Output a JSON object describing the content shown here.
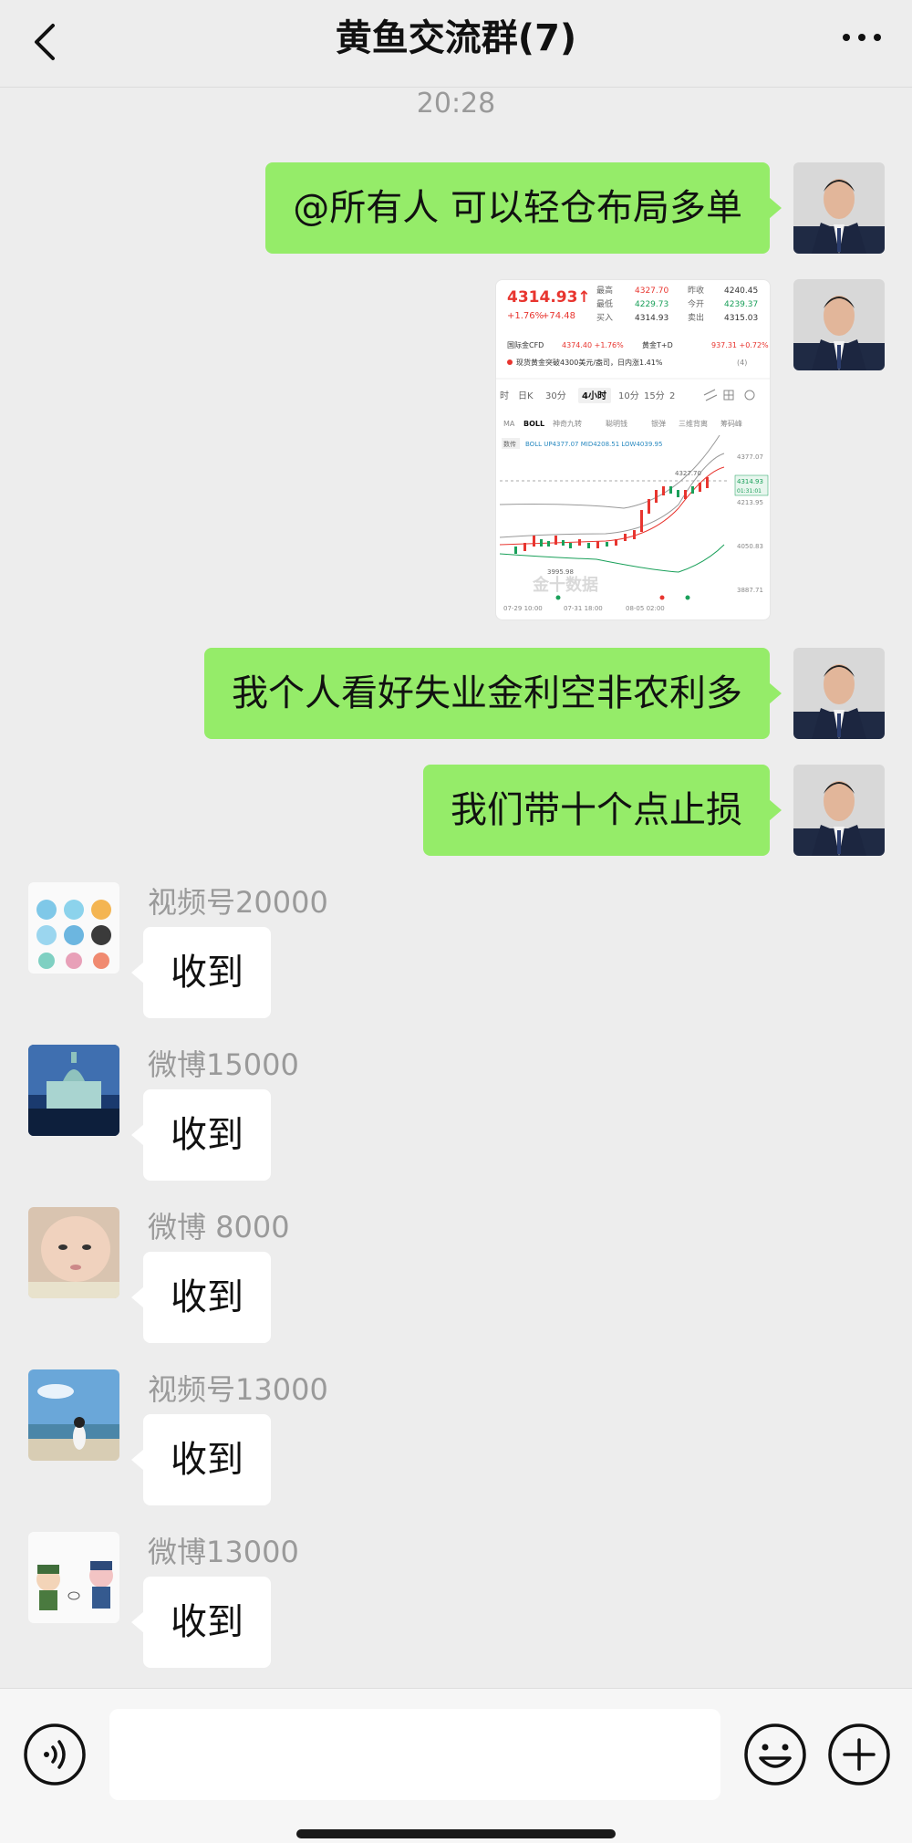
{
  "header": {
    "title": "黄鱼交流群(7)",
    "back_icon": "chevron-left-icon",
    "more_icon": "more-dots-icon"
  },
  "timestamp": "20:28",
  "self_messages": [
    {
      "text": "@所有人 可以轻仓布局多单"
    },
    {
      "text": "我个人看好失业金利空非农利多"
    },
    {
      "text": "我们带十个点止损"
    }
  ],
  "image_message": {
    "price": "4314.93↑",
    "change": "+1.76%",
    "change_abs": "+74.48",
    "stats": [
      {
        "k1": "最高",
        "v1": "4327.70",
        "k2": "昨收",
        "v2": "4240.45"
      },
      {
        "k1": "最低",
        "v1": "4229.73",
        "k2": "今开",
        "v2": "4239.37"
      },
      {
        "k1": "买入",
        "v1": "4314.93",
        "k2": "卖出",
        "v2": "4315.03"
      }
    ],
    "cfd_label": "国际金CFD",
    "cfd_value": "4374.40 +1.76%",
    "td_label": "黄金T+D",
    "td_value": "937.31 +0.72%",
    "news": "现货黄金突破4300美元/盎司，日内涨1.41%",
    "news_count": "(4)",
    "tabs": [
      "时",
      "日K",
      "30分",
      "4小时",
      "10分",
      "15分",
      "2"
    ],
    "active_tab": "4小时",
    "indicators": [
      "MA",
      "BOLL",
      "神奇九转",
      "聪明钱",
      "银弹",
      "三维背离",
      "筹码峰"
    ],
    "boll_line": "BOLL UP4377.07 MID4208.51 LOW4039.95",
    "boll_tag": "数传",
    "y_ticks": [
      "4377.07",
      "4213.95",
      "4050.83",
      "3887.71"
    ],
    "price_tag": "4314.93",
    "price_tag_time": "01:31:01",
    "high_label": "4327.70",
    "low_label": "3995.98",
    "x_ticks": [
      "07-29 10:00",
      "07-31 18:00",
      "08-05 02:00"
    ],
    "watermark": "金十数据"
  },
  "other_messages": [
    {
      "sender": "视频号20000",
      "text": "收到"
    },
    {
      "sender": "微博15000",
      "text": "收到"
    },
    {
      "sender": "微博 8000",
      "text": "收到"
    },
    {
      "sender": "视频号13000",
      "text": "收到"
    },
    {
      "sender": "微博13000",
      "text": "收到"
    }
  ],
  "input_bar": {
    "voice_icon": "voice-icon",
    "emoji_icon": "emoji-icon",
    "plus_icon": "plus-icon"
  },
  "colors": {
    "self_bubble": "#95ec69",
    "background": "#ededed",
    "up_red": "#e8352f",
    "down_green": "#1aa05a"
  }
}
